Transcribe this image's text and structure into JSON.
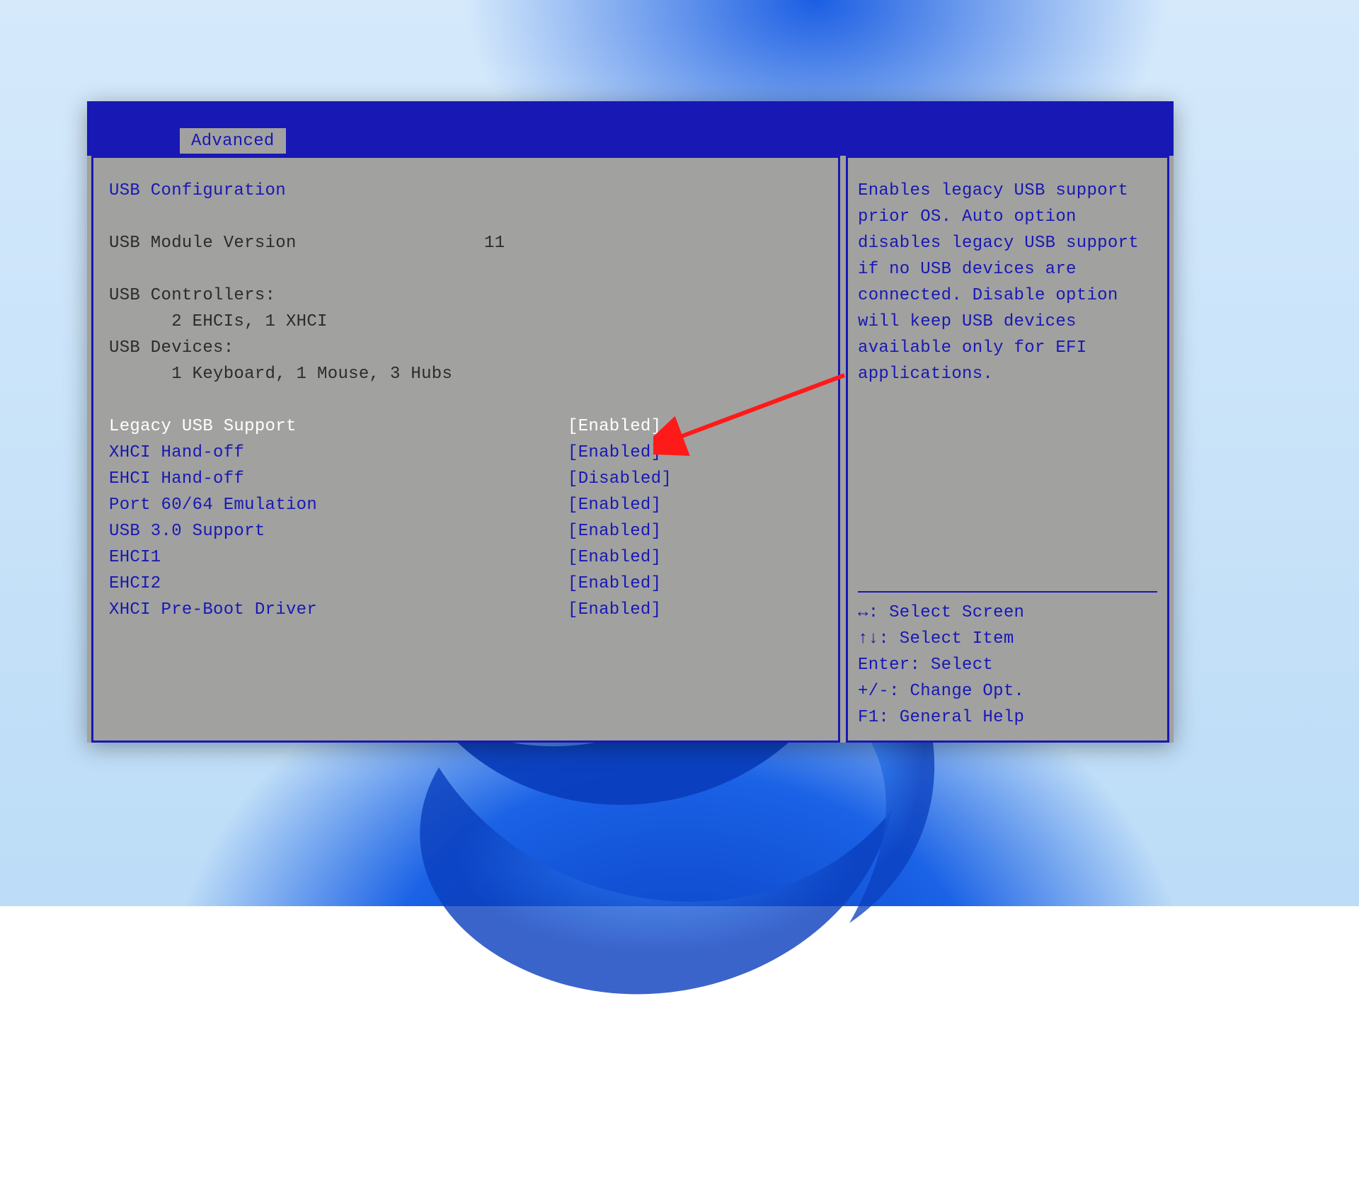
{
  "tab_label": "Advanced",
  "section_title": "USB Configuration",
  "info": {
    "usb_module_version": {
      "label": "USB Module Version",
      "value": "11"
    },
    "usb_controllers_label": "USB Controllers:",
    "usb_controllers_value": "      2 EHCIs, 1 XHCI",
    "usb_devices_label": "USB Devices:",
    "usb_devices_value": "      1 Keyboard, 1 Mouse, 3 Hubs"
  },
  "settings": [
    {
      "name": "legacy-usb-support",
      "label": "Legacy USB Support",
      "value": "[Enabled]",
      "selected": true
    },
    {
      "name": "xhci-hand-off",
      "label": "XHCI Hand-off",
      "value": "[Enabled]",
      "selected": false
    },
    {
      "name": "ehci-hand-off",
      "label": "EHCI Hand-off",
      "value": "[Disabled]",
      "selected": false
    },
    {
      "name": "port-6064-emulation",
      "label": "Port 60/64 Emulation",
      "value": "[Enabled]",
      "selected": false
    },
    {
      "name": "usb-3-0-support",
      "label": "USB 3.0 Support",
      "value": "[Enabled]",
      "selected": false
    },
    {
      "name": "ehci1",
      "label": "EHCI1",
      "value": "[Enabled]",
      "selected": false
    },
    {
      "name": "ehci2",
      "label": "EHCI2",
      "value": "[Enabled]",
      "selected": false
    },
    {
      "name": "xhci-pre-boot-driver",
      "label": "XHCI Pre-Boot Driver",
      "value": "[Enabled]",
      "selected": false
    }
  ],
  "help_text": "Enables legacy USB support prior OS. Auto option disables legacy USB support if no USB devices are connected. Disable option will keep USB devices available only for EFI applications.",
  "hotkeys": [
    "↔: Select Screen",
    "↑↓: Select Item",
    "Enter: Select",
    "+/-: Change Opt.",
    "F1: General Help"
  ]
}
